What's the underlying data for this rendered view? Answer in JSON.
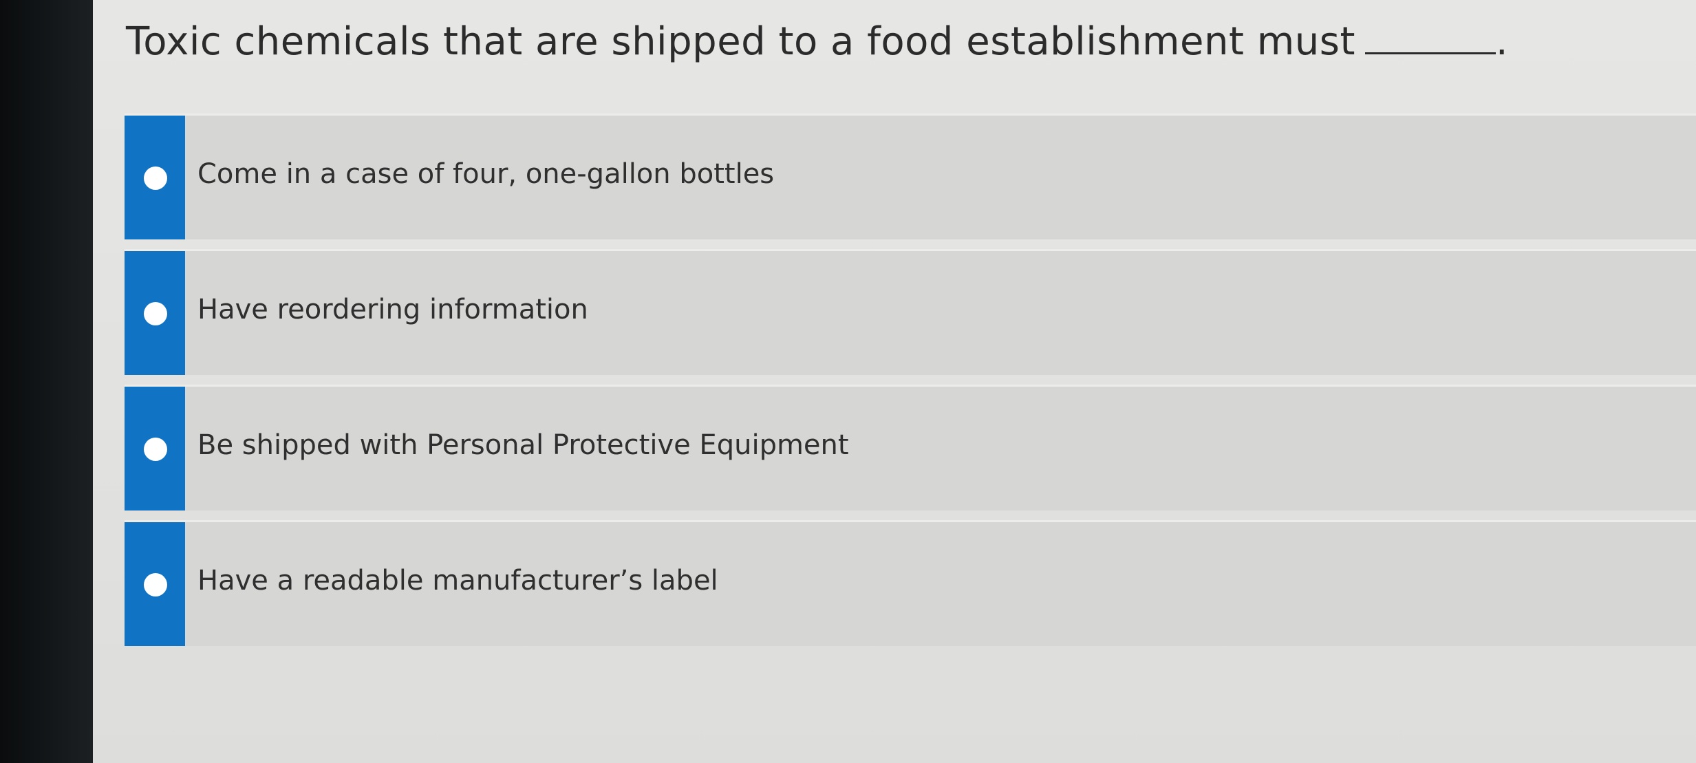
{
  "question": {
    "text": "Toxic chemicals that are shipped to a food establishment must",
    "trailing": "."
  },
  "options": [
    {
      "label": "Come in a case of four, one-gallon bottles"
    },
    {
      "label": "Have reordering information"
    },
    {
      "label": "Be shipped with Personal Protective Equipment"
    },
    {
      "label": "Have a readable manufacturer’s label"
    }
  ],
  "colors": {
    "accent": "#1173c4",
    "option_bg": "#d6d6d4",
    "page_bg": "#e4e4e2"
  }
}
